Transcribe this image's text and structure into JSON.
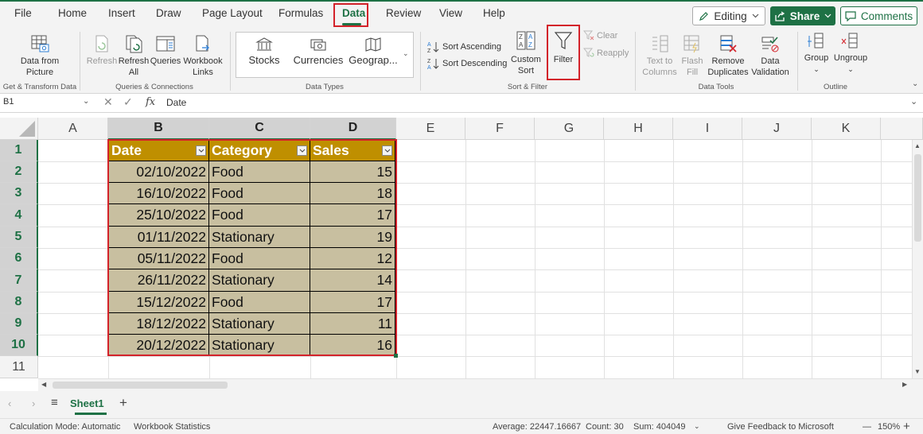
{
  "menu": {
    "tabs": [
      "File",
      "Home",
      "Insert",
      "Draw",
      "Page Layout",
      "Formulas",
      "Data",
      "Review",
      "View",
      "Help"
    ],
    "editing_label": "Editing",
    "share_label": "Share",
    "comments_label": "Comments"
  },
  "ribbon": {
    "get_transform": {
      "data_from_picture_line1": "Data from",
      "data_from_picture_line2": "Picture",
      "group_label": "Get & Transform Data"
    },
    "queries": {
      "refresh_label": "Refresh",
      "refresh_all_line1": "Refresh",
      "refresh_all_line2": "All",
      "queries_label": "Queries",
      "workbook_links_line1": "Workbook",
      "workbook_links_line2": "Links",
      "group_label": "Queries & Connections"
    },
    "data_types": {
      "stocks": "Stocks",
      "currencies": "Currencies",
      "geography": "Geograp...",
      "group_label": "Data Types"
    },
    "sort_filter": {
      "sort_ascending": "Sort Ascending",
      "sort_descending": "Sort Descending",
      "custom_sort_line1": "Custom",
      "custom_sort_line2": "Sort",
      "filter": "Filter",
      "clear": "Clear",
      "reapply": "Reapply",
      "group_label": "Sort & Filter"
    },
    "data_tools": {
      "text_to_columns_line1": "Text to",
      "text_to_columns_line2": "Columns",
      "flash_fill_line1": "Flash",
      "flash_fill_line2": "Fill",
      "remove_duplicates_line1": "Remove",
      "remove_duplicates_line2": "Duplicates",
      "data_validation_line1": "Data",
      "data_validation_line2": "Validation",
      "group_label": "Data Tools"
    },
    "outline": {
      "group": "Group",
      "ungroup": "Ungroup",
      "group_label": "Outline"
    }
  },
  "formula_bar": {
    "name_box": "B1",
    "fx": "fx",
    "content": "Date"
  },
  "grid": {
    "columns": [
      "A",
      "B",
      "C",
      "D",
      "E",
      "F",
      "G",
      "H",
      "I",
      "J",
      "K"
    ],
    "rows": [
      "1",
      "2",
      "3",
      "4",
      "5",
      "6",
      "7",
      "8",
      "9",
      "10",
      "11"
    ]
  },
  "table": {
    "headers": [
      "Date",
      "Category",
      "Sales"
    ],
    "rows": [
      [
        "02/10/2022",
        "Food",
        "15"
      ],
      [
        "16/10/2022",
        "Food",
        "18"
      ],
      [
        "25/10/2022",
        "Food",
        "17"
      ],
      [
        "01/11/2022",
        "Stationary",
        "19"
      ],
      [
        "05/11/2022",
        "Food",
        "12"
      ],
      [
        "26/11/2022",
        "Stationary",
        "14"
      ],
      [
        "15/12/2022",
        "Food",
        "17"
      ],
      [
        "18/12/2022",
        "Stationary",
        "11"
      ],
      [
        "20/12/2022",
        "Stationary",
        "16"
      ]
    ]
  },
  "sheets": {
    "active": "Sheet1"
  },
  "status": {
    "calc_mode": "Calculation Mode: Automatic",
    "workbook_stats": "Workbook Statistics",
    "average": "Average: 22447.16667",
    "count": "Count: 30",
    "sum": "Sum: 404049",
    "feedback": "Give Feedback to Microsoft",
    "zoom": "150%"
  },
  "colors": {
    "accent_green": "#1e7145",
    "header_gold": "#bf8f00",
    "body_tan": "#c8bfa0",
    "highlight_red": "#d3222a"
  }
}
